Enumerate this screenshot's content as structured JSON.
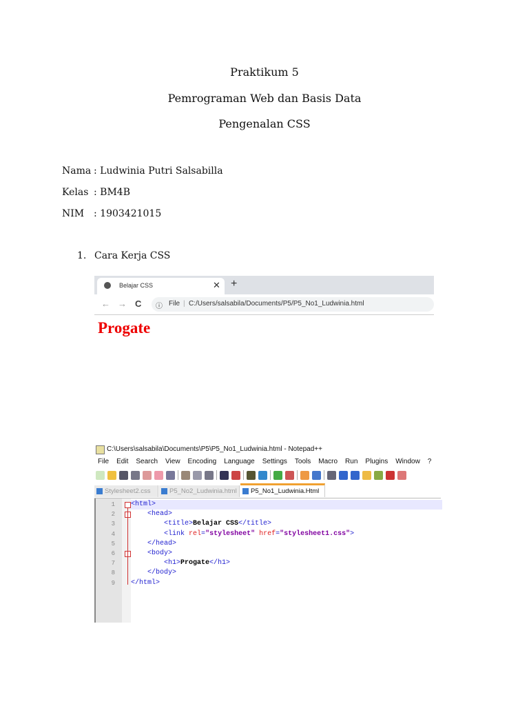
{
  "title": {
    "line1": "Praktikum 5",
    "line2": "Pemrograman Web dan Basis Data",
    "line3": "Pengenalan CSS"
  },
  "info": [
    {
      "label": "Nama",
      "value": ": Ludwinia Putri Salsabilla"
    },
    {
      "label": "Kelas",
      "value": ": BM4B"
    },
    {
      "label": "NIM",
      "value": ": 1903421015"
    }
  ],
  "list": {
    "number": "1.",
    "text": "Cara Kerja CSS"
  },
  "browser": {
    "tab_title": "Belajar CSS",
    "close": "✕",
    "new_tab": "+",
    "back": "←",
    "forward": "→",
    "reload": "C",
    "info_icon": "ⓘ",
    "file_label": "File",
    "url": "C:/Users/salsabila/Documents/P5/P5_No1_Ludwinia.html",
    "page_heading": "Progate"
  },
  "notepad": {
    "window_title": "C:\\Users\\salsabila\\Documents\\P5\\P5_No1_Ludwinia.html - Notepad++",
    "menu": [
      "File",
      "Edit",
      "Search",
      "View",
      "Encoding",
      "Language",
      "Settings",
      "Tools",
      "Macro",
      "Run",
      "Plugins",
      "Window",
      "?"
    ],
    "tabs": [
      {
        "label": "Stylesheet2.css",
        "active": false
      },
      {
        "label": "P5_No2_Ludwinia.html",
        "active": false
      },
      {
        "label": "P5_No1_Ludwinia.Html",
        "active": true
      }
    ],
    "lines": [
      [
        [
          "tag",
          "<html>"
        ]
      ],
      [
        [
          "txt",
          "    "
        ],
        [
          "tag",
          "<head>"
        ]
      ],
      [
        [
          "txt",
          "        "
        ],
        [
          "tag",
          "<title>"
        ],
        [
          "txt",
          "Belajar CSS"
        ],
        [
          "tag",
          "</title>"
        ]
      ],
      [
        [
          "txt",
          "        "
        ],
        [
          "tag",
          "<link "
        ],
        [
          "attr",
          "rel"
        ],
        [
          "tag",
          "="
        ],
        [
          "str",
          "\"stylesheet\""
        ],
        [
          "tag",
          " "
        ],
        [
          "attr",
          "href"
        ],
        [
          "tag",
          "="
        ],
        [
          "str",
          "\"stylesheet1.css\""
        ],
        [
          "tag",
          ">"
        ]
      ],
      [
        [
          "txt",
          "    "
        ],
        [
          "tag",
          "</head>"
        ]
      ],
      [
        [
          "txt",
          "    "
        ],
        [
          "tag",
          "<body>"
        ]
      ],
      [
        [
          "txt",
          "        "
        ],
        [
          "tag",
          "<h1>"
        ],
        [
          "txt",
          "Progate"
        ],
        [
          "tag",
          "</h1>"
        ]
      ],
      [
        [
          "txt",
          "    "
        ],
        [
          "tag",
          "</body>"
        ]
      ],
      [
        [
          "tag",
          "</html>"
        ]
      ]
    ]
  }
}
